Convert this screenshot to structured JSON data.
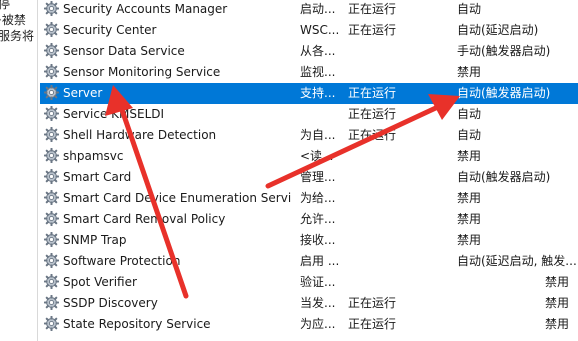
{
  "left_pane": {
    "lines": [
      "停",
      "·被禁",
      "服务将"
    ]
  },
  "services": [
    {
      "name": "Security Accounts Manager",
      "desc": "启动...",
      "status": "正在运行",
      "start": "自动"
    },
    {
      "name": "Security Center",
      "desc": "WSC...",
      "status": "正在运行",
      "start": "自动(延迟启动)"
    },
    {
      "name": "Sensor Data Service",
      "desc": "从各...",
      "status": "",
      "start": "手动(触发器启动)"
    },
    {
      "name": "Sensor Monitoring Service",
      "desc": "监视...",
      "status": "",
      "start": "禁用"
    },
    {
      "name": "Server",
      "desc": "支持...",
      "status": "正在运行",
      "start": "自动(触发器启动)",
      "selected": true
    },
    {
      "name": "Service KMSELDI",
      "desc": "",
      "status": "正在运行",
      "start": "自动"
    },
    {
      "name": "Shell Hardware Detection",
      "desc": "为自...",
      "status": "正在运行",
      "start": "自动"
    },
    {
      "name": "shpamsvc",
      "desc": "<读...",
      "status": "",
      "start": "禁用"
    },
    {
      "name": "Smart Card",
      "desc": "管理...",
      "status": "",
      "start": "自动(触发器启动)"
    },
    {
      "name": "Smart Card Device Enumeration Servi",
      "desc": "为给...",
      "status": "",
      "start": "禁用"
    },
    {
      "name": "Smart Card Removal Policy",
      "desc": "允许...",
      "status": "",
      "start": "禁用"
    },
    {
      "name": "SNMP Trap",
      "desc": "接收...",
      "status": "",
      "start": "禁用"
    },
    {
      "name": "Software Protection",
      "desc": "启用 ...",
      "status": "",
      "start": "自动(延迟启动, 触发..."
    },
    {
      "name": "Spot Verifier",
      "desc": "验证...",
      "status": "",
      "start": "禁用"
    },
    {
      "name": "SSDP Discovery",
      "desc": "当发...",
      "status": "正在运行",
      "start": "禁用"
    },
    {
      "name": "State Repository Service",
      "desc": "为应...",
      "status": "正在运行",
      "start": "禁用"
    }
  ],
  "colors": {
    "selection": "#0078d7",
    "arrow": "#e8312a"
  },
  "icon": "gear-icon"
}
